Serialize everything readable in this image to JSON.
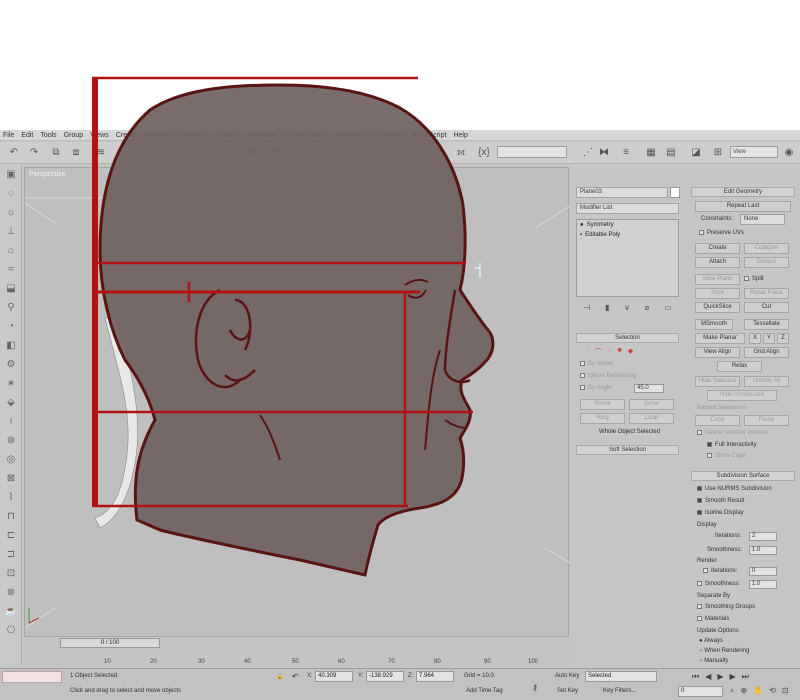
{
  "menu": [
    "File",
    "Edit",
    "Tools",
    "Group",
    "Views",
    "Create",
    "Modifiers",
    "Character",
    "reactor",
    "Animation",
    "Graph Editors",
    "Rendering",
    "Customize",
    "MAXScript",
    "Help"
  ],
  "toolbar": {
    "view_label": "View"
  },
  "viewport": {
    "label": "Perspective"
  },
  "command_panel": {
    "object_name": "Plane03",
    "modifier_list": "Modifier List",
    "stack": [
      {
        "label": "Symmetry",
        "icon": "lightbulb-icon"
      },
      {
        "label": "Editable Poly",
        "icon": "square-icon"
      }
    ],
    "selection_title": "Selection",
    "selection_options": [
      "By Vertex",
      "Ignore Backfacing",
      "By Angle:"
    ],
    "by_angle_value": "45.0",
    "shrink_label": "Shrink",
    "grow_label": "Grow",
    "ring_label": "Ring",
    "loop_label": "Loop",
    "selection_status": "Whole Object Selected",
    "soft_selection": "Soft Selection"
  },
  "edit_geometry": {
    "title": "Edit Geometry",
    "repeat_last": "Repeat Last",
    "constraints_label": "Constraints:",
    "constraints_value": "None",
    "preserve_uvs": "Preserve UVs",
    "create": "Create",
    "collapse": "Collapse",
    "attach": "Attach",
    "detach": "Detach",
    "slice_plane": "Slice Plane",
    "split": "Split",
    "slice": "Slice",
    "reset_plane": "Reset Plane",
    "quickslice": "QuickSlice",
    "cut": "Cut",
    "msmooth": "MSmooth",
    "tessellate": "Tessellate",
    "make_planar": "Make Planar",
    "x": "X",
    "y": "Y",
    "z": "Z",
    "view_align": "View Align",
    "grid_align": "Grid Align",
    "relax": "Relax",
    "hide_selected": "Hide Selected",
    "unhide_all": "Unhide All",
    "hide_unselected": "Hide Unselected",
    "named_selections": "Named Selections:",
    "copy": "Copy",
    "paste": "Paste",
    "delete_isolated": "Delete Isolated Vertices",
    "full_interactivity": "Full Interactivity",
    "show_cage": "Show Cage"
  },
  "subdivision": {
    "title": "Subdivision Surface",
    "use_nurms": "Use NURMS Subdivision",
    "smooth_result": "Smooth Result",
    "isoline_display": "Isoline Display",
    "display_label": "Display",
    "iterations_label": "Iterations:",
    "iterations_value": "2",
    "smoothness_label": "Smoothness:",
    "smoothness_value": "1.0",
    "render_label": "Render",
    "render_iterations_value": "0",
    "render_smoothness_value": "1.0",
    "separate_by": "Separate By",
    "smoothing_groups": "Smoothing Groups",
    "materials": "Materials",
    "update_options": "Update Options",
    "always": "Always",
    "when_rendering": "When Rendering",
    "manually": "Manually"
  },
  "timeline": {
    "slider": "0 / 100",
    "ticks": [
      "10",
      "20",
      "30",
      "40",
      "50",
      "60",
      "70",
      "80",
      "90",
      "100"
    ]
  },
  "status": {
    "objects_selected": "1 Object Selected",
    "hint": "Click and drag to select and move objects",
    "x_label": "X:",
    "x_value": "40.309",
    "y_label": "Y:",
    "y_value": "-138.929",
    "z_label": "Z:",
    "z_value": "7.964",
    "grid": "Grid = 10.0",
    "add_time_tag": "Add Time Tag",
    "auto_key": "Auto Key",
    "set_key": "Set Key",
    "selected": "Selected",
    "key_filters": "Key Filters...",
    "frame_value": "0"
  },
  "colors": {
    "sketch_red": "#b31212",
    "sketch_dark": "#5a1414",
    "head_fill": "#6f6261"
  }
}
